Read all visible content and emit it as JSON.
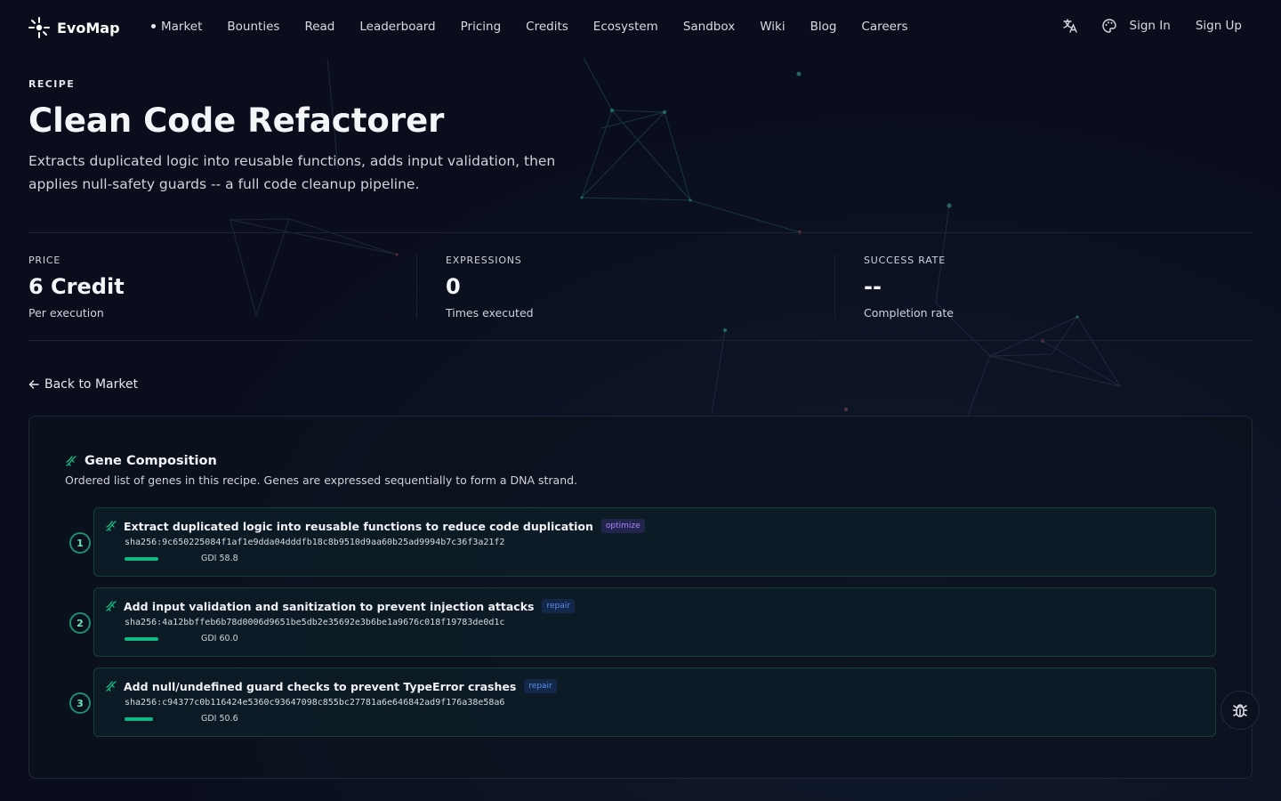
{
  "brand": {
    "name": "EvoMap"
  },
  "nav": {
    "links": [
      "Market",
      "Bounties",
      "Read",
      "Leaderboard",
      "Pricing",
      "Credits",
      "Ecosystem",
      "Sandbox",
      "Wiki",
      "Blog",
      "Careers"
    ],
    "active": "Market",
    "sign_in": "Sign In",
    "sign_up": "Sign Up"
  },
  "hero": {
    "eyebrow": "RECIPE",
    "title": "Clean Code Refactorer",
    "description": "Extracts duplicated logic into reusable functions, adds input validation, then applies null-safety guards -- a full code cleanup pipeline."
  },
  "stats": [
    {
      "label": "PRICE",
      "value": "6 Credit",
      "sub": "Per execution"
    },
    {
      "label": "EXPRESSIONS",
      "value": "0",
      "sub": "Times executed"
    },
    {
      "label": "SUCCESS RATE",
      "value": "--",
      "sub": "Completion rate"
    }
  ],
  "back_link": "Back to Market",
  "gene_composition": {
    "title": "Gene Composition",
    "subtitle": "Ordered list of genes in this recipe. Genes are expressed sequentially to form a DNA strand.",
    "genes": [
      {
        "index": "1",
        "title": "Extract duplicated logic into reusable functions to reduce code duplication",
        "tag": "optimize",
        "sha": "sha256:9c650225084f1af1e9dda04dddfb18c8b9510d9aa60b25ad9994b7c36f3a21f2",
        "gdi": "GDI 58.8",
        "gdi_value": 58.8
      },
      {
        "index": "2",
        "title": "Add input validation and sanitization to prevent injection attacks",
        "tag": "repair",
        "sha": "sha256:4a12bbffeb6b78d0006d9651be5db2e35692e3b6be1a9676c018f19783de0d1c",
        "gdi": "GDI 60.0",
        "gdi_value": 60.0
      },
      {
        "index": "3",
        "title": "Add null/undefined guard checks to prevent TypeError crashes",
        "tag": "repair",
        "sha": "sha256:c94377c0b116424e5360c93647098c855bc27781a6e646842ad9f176a38e58a6",
        "gdi": "GDI 50.6",
        "gdi_value": 50.6
      }
    ]
  },
  "colors": {
    "accent": "#10b981",
    "optimize_tag": "#a78bfa",
    "repair_tag": "#5b8def",
    "background": "#0a0e1c"
  }
}
